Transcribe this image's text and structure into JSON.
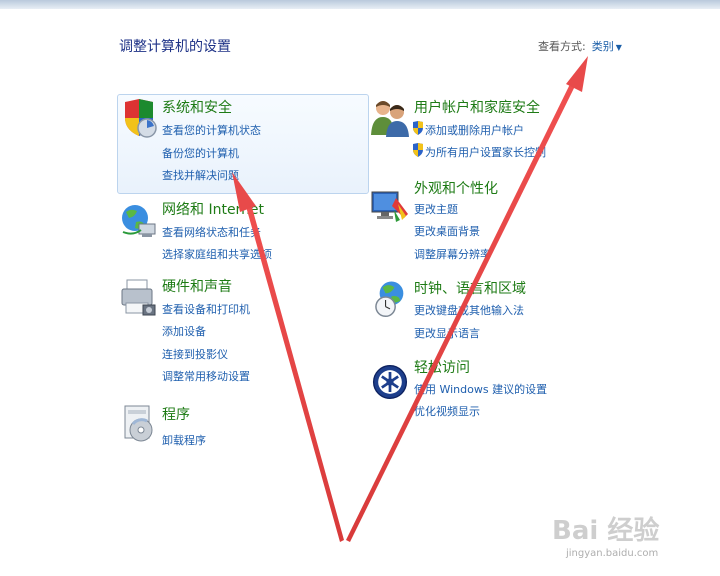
{
  "page": {
    "title": "调整计算机的设置",
    "view_by_label": "查看方式:",
    "view_by_value": "类别",
    "view_by_arrow": "▼"
  },
  "categories": {
    "system_security": {
      "title": "系统和安全",
      "links": [
        "查看您的计算机状态",
        "备份您的计算机",
        "查找并解决问题"
      ],
      "icon": "shield-icon"
    },
    "network": {
      "title": "网络和 Internet",
      "links": [
        "查看网络状态和任务",
        "选择家庭组和共享选项"
      ],
      "icon": "network-globe-icon"
    },
    "hardware": {
      "title": "硬件和声音",
      "links": [
        "查看设备和打印机",
        "添加设备",
        "连接到投影仪",
        "调整常用移动设置"
      ],
      "icon": "printer-icon"
    },
    "programs": {
      "title": "程序",
      "links": [
        "卸载程序"
      ],
      "icon": "programs-icon"
    },
    "user_accounts": {
      "title": "用户帐户和家庭安全",
      "links": [
        "添加或删除用户帐户",
        "为所有用户设置家长控制"
      ],
      "icon": "users-icon"
    },
    "appearance": {
      "title": "外观和个性化",
      "links": [
        "更改主题",
        "更改桌面背景",
        "调整屏幕分辨率"
      ],
      "icon": "appearance-icon"
    },
    "clock_region": {
      "title": "时钟、语言和区域",
      "links": [
        "更改键盘或其他输入法",
        "更改显示语言"
      ],
      "icon": "clock-globe-icon"
    },
    "ease_access": {
      "title": "轻松访问",
      "links": [
        "使用 Windows 建议的设置",
        "优化视频显示"
      ],
      "icon": "ease-of-access-icon"
    }
  },
  "colors": {
    "title_green": "#1e7b15",
    "link_blue": "#1f5fae",
    "arrow_red": "#e84a4a"
  },
  "watermark": {
    "brand": "Bai 经验",
    "url": "jingyan.baidu.com"
  }
}
